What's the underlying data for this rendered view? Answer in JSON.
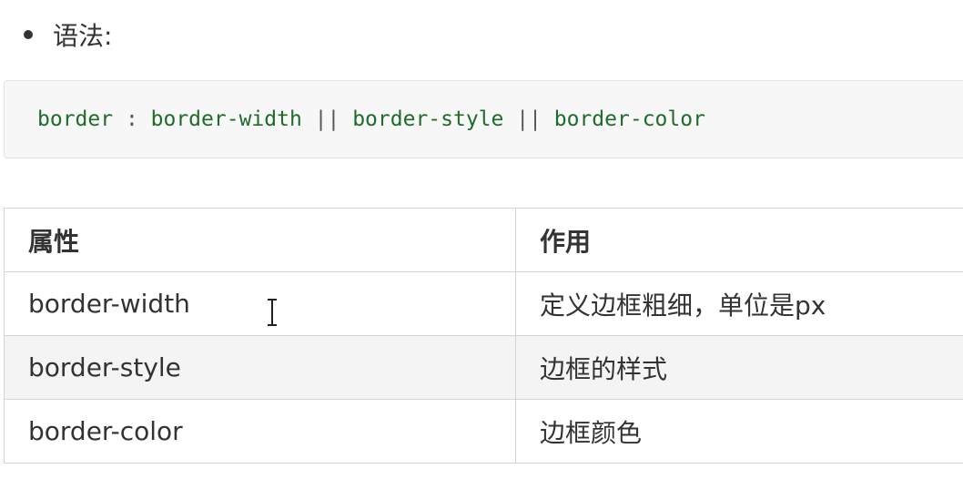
{
  "syntax": {
    "bullet_label": "语法:"
  },
  "code": {
    "tokens": [
      {
        "text": "border",
        "kind": "prop"
      },
      {
        "text": " : ",
        "kind": "punct"
      },
      {
        "text": "border-width",
        "kind": "prop"
      },
      {
        "text": " || ",
        "kind": "punct"
      },
      {
        "text": "border-style",
        "kind": "prop"
      },
      {
        "text": " || ",
        "kind": "punct"
      },
      {
        "text": "border-color",
        "kind": "prop"
      }
    ]
  },
  "table": {
    "headers": [
      "属性",
      "作用"
    ],
    "rows": [
      [
        "border-width",
        "定义边框粗细，单位是px"
      ],
      [
        "border-style",
        "边框的样式"
      ],
      [
        "border-color",
        "边框颜色"
      ]
    ]
  },
  "colors": {
    "code_property": "#1f6b2c",
    "text": "#333333",
    "table_border": "#d4d4d4",
    "code_background": "#f7f7f7"
  },
  "icons": {
    "cursor": "text-cursor-icon"
  }
}
